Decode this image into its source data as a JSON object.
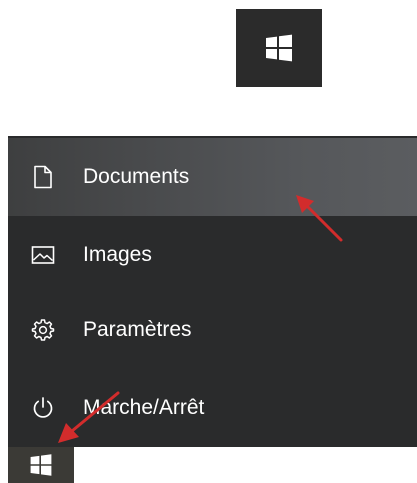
{
  "menu": {
    "items": [
      {
        "label": "Documents",
        "icon": "document-icon"
      },
      {
        "label": "Images",
        "icon": "image-icon"
      },
      {
        "label": "Paramètres",
        "icon": "gear-icon"
      },
      {
        "label": "Marche/Arrêt",
        "icon": "power-icon"
      }
    ]
  },
  "icons": {
    "start": "windows-logo-icon"
  },
  "colors": {
    "menu_bg": "#2a2b2c",
    "highlight": "#55575a",
    "taskbar": "#3b3a36",
    "arrow": "#d22c2c"
  }
}
